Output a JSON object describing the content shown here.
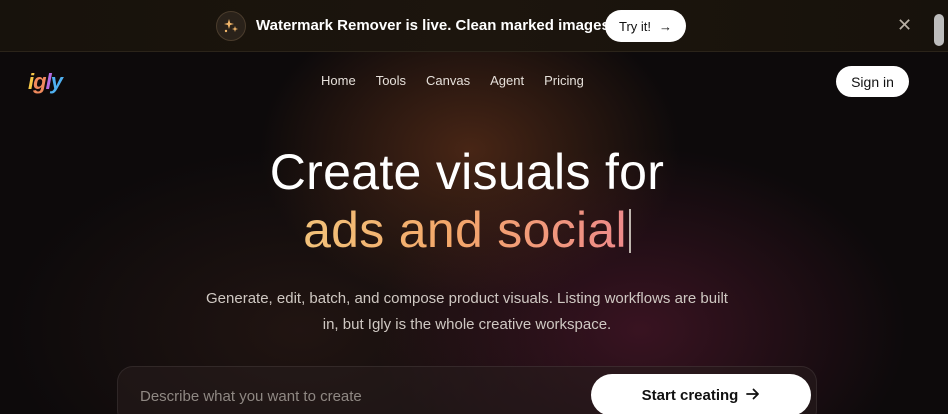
{
  "announcement": {
    "icon": "sparkle-icon",
    "text": "Watermark Remover is live. Clean marked images fast.",
    "cta_label": "Try it!",
    "cta_icon": "arrow-right-icon",
    "close_icon": "close-icon"
  },
  "brand": {
    "logo_letters": [
      "i",
      "g",
      "l",
      "y"
    ],
    "logo_colors": [
      "#f7c948",
      "#f08a5d",
      "#b56ce0",
      "#4fb0f0"
    ]
  },
  "nav": {
    "items": [
      {
        "label": "Home"
      },
      {
        "label": "Tools"
      },
      {
        "label": "Canvas"
      },
      {
        "label": "Agent"
      },
      {
        "label": "Pricing"
      }
    ],
    "signin_label": "Sign in"
  },
  "hero": {
    "headline_line1": "Create visuals for",
    "headline_line2": "ads and social",
    "subtitle": "Generate, edit, batch, and compose product visuals. Listing workflows are built in, but Igly is the whole creative workspace."
  },
  "prompt": {
    "placeholder": "Describe what you want to create",
    "value": "",
    "submit_label": "Start creating",
    "submit_icon": "arrow-right-icon"
  },
  "colors": {
    "accent_gradient_start": "#f2c27a",
    "accent_gradient_end": "#ee8a8a",
    "button_bg": "#ffffff",
    "page_bg": "#0d0a0b"
  }
}
